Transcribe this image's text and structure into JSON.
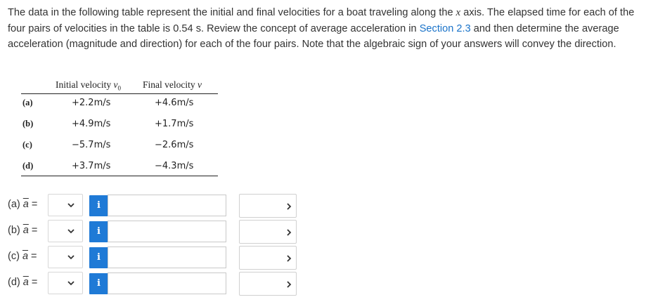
{
  "prompt": {
    "part1": "The data in the following table represent the initial and final velocities for a boat traveling along the ",
    "x_var": "x",
    "part2": " axis. The elapsed time for each of the four pairs of velocities in the table is 0.54 s. Review the concept of average acceleration in ",
    "link": "Section 2.3",
    "part3": " and then determine the average acceleration (magnitude and direction) for each of the four pairs. Note that the algebraic sign of your answers will convey the direction."
  },
  "table": {
    "header_initial": "Initial velocity ",
    "header_initial_var": "v",
    "header_initial_sub": "0",
    "header_final": "Final velocity ",
    "header_final_var": "v",
    "rows": [
      {
        "label": "(a)",
        "initial": "+2.2m/s",
        "final": "+4.6m/s"
      },
      {
        "label": "(b)",
        "initial": "+4.9m/s",
        "final": "+1.7m/s"
      },
      {
        "label": "(c)",
        "initial": "−5.7m/s",
        "final": "−2.6m/s"
      },
      {
        "label": "(d)",
        "initial": "+3.7m/s",
        "final": "−4.3m/s"
      }
    ]
  },
  "answers": [
    {
      "prefix": "(a)",
      "symbol": "a",
      "equals": " =",
      "info": "i"
    },
    {
      "prefix": "(b)",
      "symbol": "a",
      "equals": " =",
      "info": "i"
    },
    {
      "prefix": "(c)",
      "symbol": "a",
      "equals": " =",
      "info": "i"
    },
    {
      "prefix": "(d)",
      "symbol": "a",
      "equals": " =",
      "info": "i"
    }
  ],
  "icons": {
    "select_chevron": "chevron-down-icon",
    "unit_chevron": "chevron-right-icon"
  },
  "colors": {
    "link": "#1a73c9",
    "info_button": "#1f7ad6"
  }
}
